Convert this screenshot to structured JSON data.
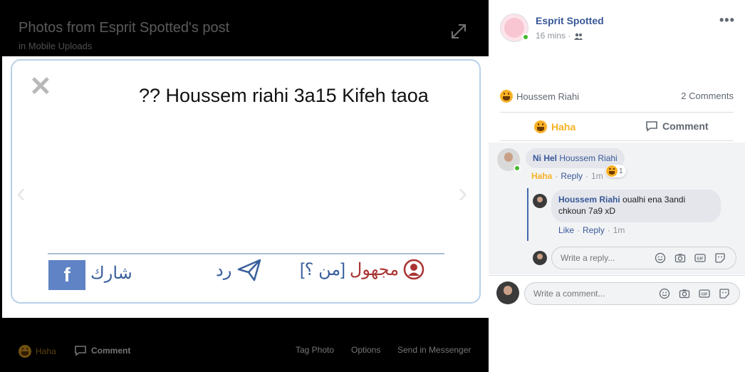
{
  "viewer": {
    "title": "Photos from Esprit Spotted's post",
    "subtitle": "in Mobile Uploads",
    "photo": {
      "question": "?? Houssem riahi 3a15 Kifeh taoa",
      "share_label": "شارك",
      "fb_letter": "f",
      "reply_label": "رد",
      "anon_label": "مجهول",
      "anon_who": "[من ؟]"
    },
    "actions": {
      "haha": "Haha",
      "comment": "Comment",
      "tag_photo": "Tag Photo",
      "options": "Options",
      "send_messenger": "Send in Messenger"
    }
  },
  "panel": {
    "page_name": "Esprit Spotted",
    "time": "16 mins",
    "reaction_name": "Houssem Riahi",
    "comments_count": "2 Comments",
    "btn_haha": "Haha",
    "btn_comment": "Comment",
    "comment1": {
      "author": "Ni Hel",
      "text": "Houssem Riahi",
      "reaction": "Haha",
      "reply": "Reply",
      "time": "1m",
      "count": "1"
    },
    "reply1": {
      "author": "Houssem Riahi",
      "text": "oualhi ena 3andi chkoun 7a9 xD",
      "like": "Like",
      "reply": "Reply",
      "time": "1m"
    },
    "reply_placeholder": "Write a reply...",
    "comment_placeholder": "Write a comment...",
    "gif_label": "GIF",
    "colors": {
      "link": "#385898",
      "haha": "#f7b125",
      "online": "#42b72a"
    }
  }
}
